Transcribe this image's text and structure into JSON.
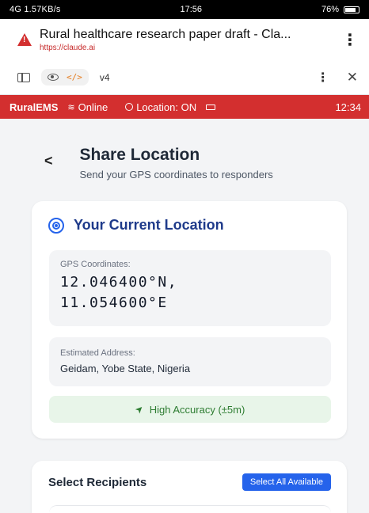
{
  "status_bar": {
    "signal": "4G 1.57KB/s",
    "time": "17:56",
    "battery": "76%"
  },
  "browser": {
    "page_title": "Rural healthcare research paper draft - Cla...",
    "url": "https://claude.ai"
  },
  "toolbar": {
    "version": "v4",
    "code_label": "</>"
  },
  "app_bar": {
    "brand": "RuralEMS",
    "status": "Online",
    "location": "Location: ON",
    "time": "12:34"
  },
  "share": {
    "back": "<",
    "title": "Share Location",
    "subtitle": "Send your GPS coordinates to responders"
  },
  "location_card": {
    "title": "Your Current Location",
    "gps_label": "GPS Coordinates:",
    "gps_value": "12.046400°N,\n11.054600°E",
    "address_label": "Estimated Address:",
    "address_value": "Geidam, Yobe State, Nigeria",
    "accuracy": "High Accuracy (±5m)"
  },
  "recipients": {
    "title": "Select Recipients",
    "select_all": "Select All Available"
  },
  "colors": {
    "brand_red": "#d32f2f",
    "accent_blue": "#2563eb",
    "accuracy_green": "#2e7d32"
  }
}
